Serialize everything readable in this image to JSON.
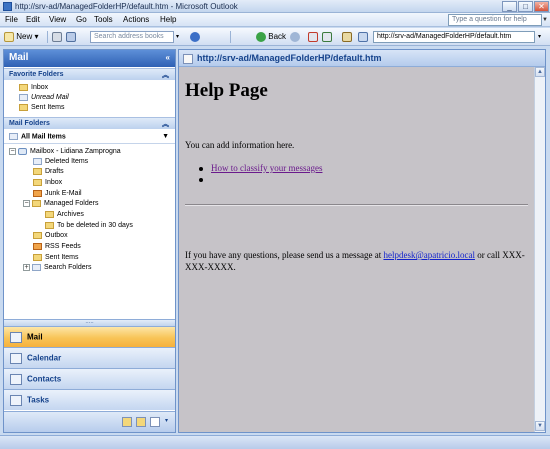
{
  "window": {
    "title": "http://srv-ad/ManagedFolderHP/default.htm - Microsoft Outlook",
    "minimize": "_",
    "maximize": "□",
    "close": "✕"
  },
  "menu": {
    "items": [
      "File",
      "Edit",
      "View",
      "Go",
      "Tools",
      "Actions",
      "Help"
    ],
    "ask_placeholder": "Type a question for help"
  },
  "toolbar": {
    "new_label": "New",
    "search_placeholder": "Search address books",
    "back_label": "Back",
    "url": "http://srv-ad/ManagedFolderHP/default.htm"
  },
  "leftpane": {
    "title": "Mail",
    "favorites_header": "Favorite Folders",
    "favorites": [
      "Inbox",
      "Unread Mail",
      "Sent Items"
    ],
    "mailfolders_header": "Mail Folders",
    "all_mail": "All Mail Items",
    "mailbox": "Mailbox - Lidiana Zamprogna",
    "folders": [
      "Deleted Items",
      "Drafts",
      "Inbox",
      "Junk E-Mail",
      "Managed Folders",
      "Archives",
      "To be deleted in 30 days",
      "Outbox",
      "RSS Feeds",
      "Sent Items",
      "Search Folders"
    ],
    "nav": [
      "Mail",
      "Calendar",
      "Contacts",
      "Tasks"
    ],
    "splitter": "....."
  },
  "rightpane": {
    "header": "http://srv-ad/ManagedFolderHP/default.htm",
    "heading": "Help Page",
    "intro": "You can add information here.",
    "link1": "How to classify your messages",
    "contact_before": "If you have any questions, please send us a message at ",
    "contact_email": "helpdesk@apatricio.local",
    "contact_after": " or call XXX-XXX-XXXX."
  }
}
